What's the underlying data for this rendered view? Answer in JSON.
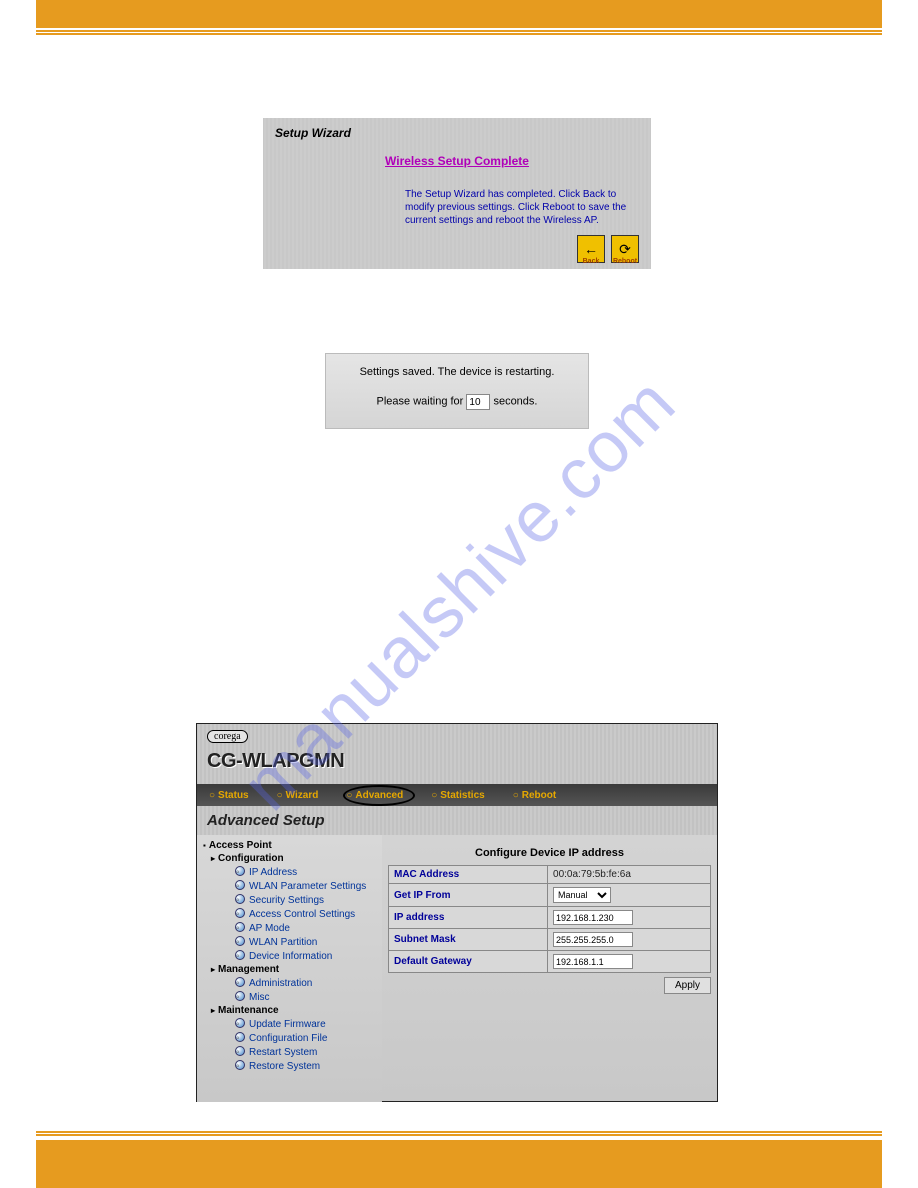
{
  "wizard": {
    "title": "Setup Wizard",
    "heading": "Wireless Setup Complete",
    "text": "The Setup Wizard has completed. Click Back to modify previous settings. Click Reboot to save the current settings and reboot the Wireless AP.",
    "back_arrow": "←",
    "back_label": "Back",
    "reboot_icon": "⟳",
    "reboot_label": "Reboot"
  },
  "restart": {
    "line1": "Settings saved. The device is restarting.",
    "line2a": "Please waiting for ",
    "count": "10",
    "line2b": " seconds."
  },
  "advanced": {
    "logo": "corega",
    "model": "CG-WLAPGMN",
    "nav": [
      "Status",
      "Wizard",
      "Advanced",
      "Statistics",
      "Reboot"
    ],
    "subtitle": "Advanced Setup",
    "tree": {
      "root": "Access Point",
      "groups": [
        {
          "label": "Configuration",
          "items": [
            "IP Address",
            "WLAN  Parameter Settings",
            "Security Settings",
            "Access Control Settings",
            "AP Mode",
            "WLAN  Partition",
            "Device Information"
          ]
        },
        {
          "label": "Management",
          "items": [
            "Administration",
            "Misc"
          ]
        },
        {
          "label": "Maintenance",
          "items": [
            "Update Firmware",
            "Configuration File",
            "Restart System",
            "Restore System"
          ]
        }
      ]
    },
    "form": {
      "title": "Configure Device IP address",
      "rows": {
        "mac_label": "MAC Address",
        "mac_value": "00:0a:79:5b:fe:6a",
        "getip_label": "Get IP From",
        "getip_value": "Manual",
        "ip_label": "IP address",
        "ip_value": "192.168.1.230",
        "sm_label": "Subnet Mask",
        "sm_value": "255.255.255.0",
        "gw_label": "Default Gateway",
        "gw_value": "192.168.1.1"
      },
      "apply": "Apply"
    }
  },
  "watermark": "manualshive.com"
}
